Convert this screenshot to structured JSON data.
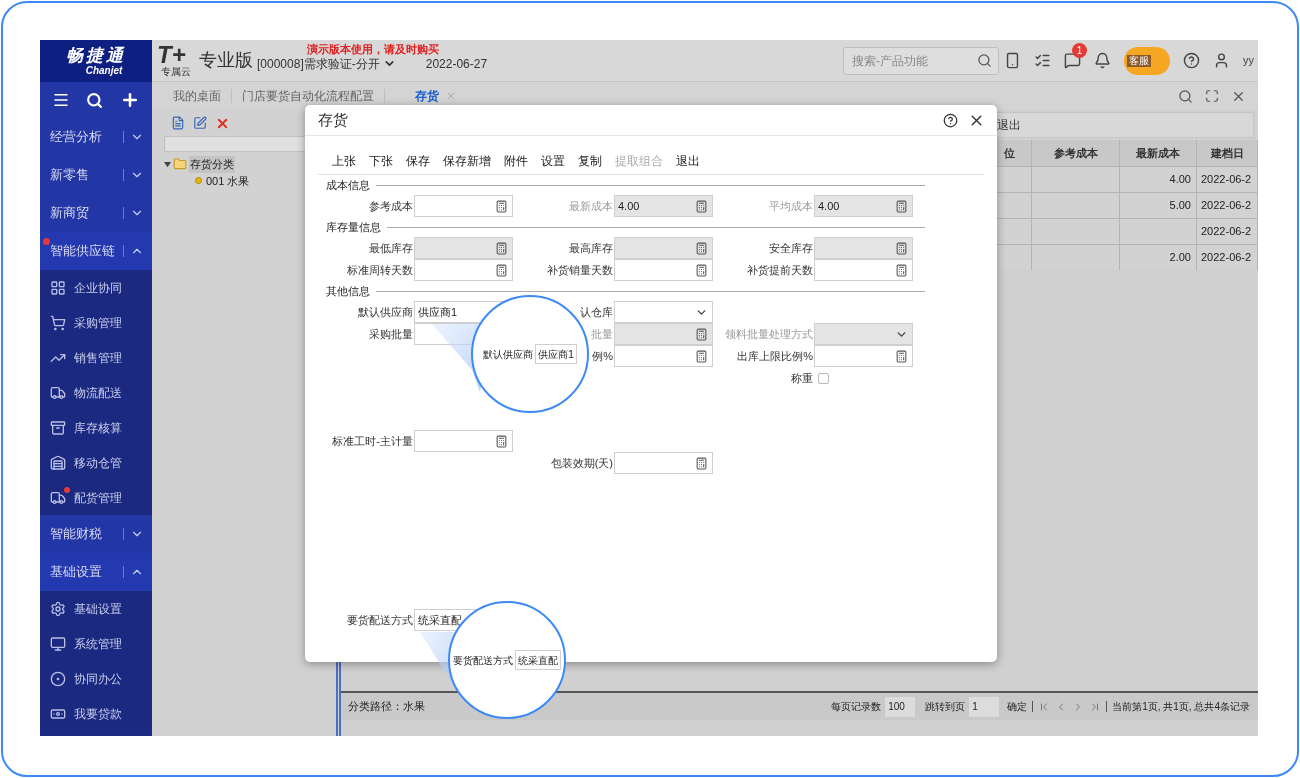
{
  "brand": {
    "logo": "畅捷通",
    "logo_sub": "Chanjet"
  },
  "sidebar": {
    "groups": [
      {
        "label": "经营分析",
        "expanded": false,
        "alert": false
      },
      {
        "label": "新零售",
        "expanded": false,
        "alert": false
      },
      {
        "label": "新商贸",
        "expanded": false,
        "alert": false
      },
      {
        "label": "智能供应链",
        "expanded": true,
        "alert": true,
        "items": [
          {
            "label": "企业协同",
            "alert": false
          },
          {
            "label": "采购管理",
            "alert": false
          },
          {
            "label": "销售管理",
            "alert": false
          },
          {
            "label": "物流配送",
            "alert": false
          },
          {
            "label": "库存核算",
            "alert": false
          },
          {
            "label": "移动仓管",
            "alert": false
          },
          {
            "label": "配货管理",
            "alert": true
          }
        ]
      },
      {
        "label": "智能财税",
        "expanded": false,
        "alert": false
      },
      {
        "label": "基础设置",
        "expanded": true,
        "alert": false,
        "items": [
          {
            "label": "基础设置",
            "alert": false
          },
          {
            "label": "系统管理",
            "alert": false
          },
          {
            "label": "协同办公",
            "alert": false
          },
          {
            "label": "我要贷款",
            "alert": false
          }
        ]
      }
    ]
  },
  "header": {
    "product_logo": "T+",
    "product_logo_sub": "专属云",
    "edition": "专业版",
    "account": "[000008]需求验证-分开",
    "date": "2022-06-27",
    "notice": "演示版本使用，请及时购买",
    "search": {
      "placeholder": "搜索-产品功能"
    },
    "message_count": "1",
    "mascot_label": "客服",
    "user": "yy"
  },
  "tabs": [
    {
      "label": "我的桌面",
      "selected": false
    },
    {
      "label": "门店要货自动化流程配置",
      "selected": false
    },
    {
      "label": "存货",
      "selected": true
    }
  ],
  "tree": [
    {
      "label": "存货分类",
      "expanded": true,
      "selected": true,
      "children": [
        {
          "label": "001 水果",
          "selected": false
        }
      ]
    }
  ],
  "list": {
    "toolbar": [
      "退出"
    ],
    "table": {
      "columns": [
        "位",
        "参考成本",
        "最新成本",
        "建档日"
      ],
      "rows": [
        {
          "latest_cost": "4.00",
          "created": "2022-06-2"
        },
        {
          "latest_cost": "5.00",
          "created": "2022-06-2"
        },
        {
          "created": "2022-06-2"
        },
        {
          "latest_cost": "2.00",
          "created": "2022-06-2"
        }
      ]
    }
  },
  "footer": {
    "path": "分类路径：水果",
    "page_size_label": "每页记录数",
    "page_size": "100",
    "jump_label": "跳转到页",
    "jump_page": "1",
    "confirm": "确定",
    "summary": "当前第1页, 共1页, 总共4条记录"
  },
  "dialog": {
    "title": "存货",
    "toolbar": [
      {
        "label": "上张",
        "disabled": false
      },
      {
        "label": "下张",
        "disabled": false
      },
      {
        "label": "保存",
        "disabled": false
      },
      {
        "label": "保存新增",
        "disabled": false
      },
      {
        "label": "附件",
        "disabled": false
      },
      {
        "label": "设置",
        "disabled": false
      },
      {
        "label": "复制",
        "disabled": false
      },
      {
        "label": "提取组合",
        "disabled": true
      },
      {
        "label": "退出",
        "disabled": false
      }
    ],
    "sections": [
      {
        "title": "成本信息",
        "rows": [
          [
            {
              "kind": "calc",
              "label": "参考成本",
              "disabled": false,
              "label_greyed": false
            },
            {
              "kind": "calc",
              "label": "最新成本",
              "value": "4.00",
              "disabled": true,
              "label_greyed": true
            },
            {
              "kind": "calc",
              "label": "平均成本",
              "value": "4.00",
              "disabled": true,
              "label_greyed": true
            }
          ]
        ]
      },
      {
        "title": "库存量信息",
        "rows": [
          [
            {
              "kind": "calc",
              "label": "最低库存",
              "disabled": true,
              "label_greyed": false
            },
            {
              "kind": "calc",
              "label": "最高库存",
              "disabled": true,
              "label_greyed": false
            },
            {
              "kind": "calc",
              "label": "安全库存",
              "disabled": true,
              "label_greyed": false
            }
          ],
          [
            {
              "kind": "calc",
              "label": "标准周转天数",
              "disabled": false,
              "label_greyed": false
            },
            {
              "kind": "calc",
              "label": "补货销量天数",
              "disabled": false,
              "label_greyed": false
            },
            {
              "kind": "calc",
              "label": "补货提前天数",
              "disabled": false,
              "label_greyed": false
            }
          ]
        ]
      },
      {
        "title": "其他信息",
        "rows": [
          [
            {
              "kind": "text",
              "label": "默认供应商",
              "value": "供应商1",
              "disabled": false,
              "label_greyed": false
            },
            {
              "kind": "select",
              "label": "认仓库",
              "disabled": false,
              "label_greyed": false
            },
            null
          ],
          [
            {
              "kind": "text",
              "label": "采购批量",
              "disabled": false,
              "label_greyed": false
            },
            {
              "kind": "calc",
              "label": "批量",
              "disabled": true,
              "label_greyed": true
            },
            {
              "kind": "select",
              "label": "领料批量处理方式",
              "disabled": true,
              "label_greyed": true
            }
          ],
          [
            null,
            {
              "kind": "calc",
              "label": "例%",
              "disabled": false,
              "label_greyed": false
            },
            {
              "kind": "calc",
              "label": "出库上限比例%",
              "disabled": false,
              "label_greyed": false
            }
          ],
          [
            null,
            null,
            {
              "kind": "checkbox",
              "label": "称重",
              "checked": false,
              "disabled": false,
              "label_greyed": false
            }
          ]
        ]
      }
    ],
    "extra_rows": [
      [
        {
          "kind": "calc",
          "label": "标准工时-主计量",
          "disabled": false,
          "label_greyed": false
        },
        null,
        null
      ],
      [
        null,
        {
          "kind": "calc",
          "label": "包装效期(天)",
          "disabled": false,
          "label_greyed": false
        },
        null
      ]
    ],
    "bottom_rows": [
      [
        {
          "kind": "text",
          "label": "要货配送方式",
          "value": "统采直配",
          "disabled": false,
          "label_greyed": false
        },
        null,
        null
      ]
    ]
  },
  "magnifiers": [
    {
      "label": "默认供应商",
      "value": "供应商1"
    },
    {
      "label": "要货配送方式",
      "value": "统采直配"
    }
  ]
}
